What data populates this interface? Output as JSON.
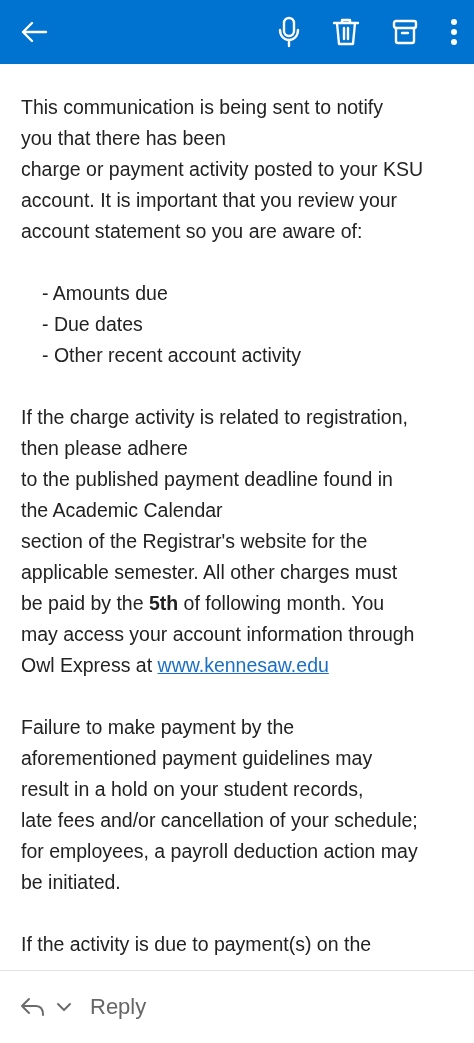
{
  "message": {
    "blocks": [
      {
        "kind": "paragraph",
        "lines": [
          "This communication is being sent to notify",
          "you that there has been",
          "charge or payment activity posted to your KSU",
          "account. It is important that you review your",
          "account statement so you are aware of:"
        ]
      },
      {
        "kind": "list",
        "lines": [
          "- Amounts due",
          "- Due dates",
          "- Other recent account activity"
        ]
      },
      {
        "kind": "paragraph",
        "lines": [
          "If the charge activity is related to registration,",
          "then please adhere",
          "to the published payment deadline found in",
          "the Academic Calendar",
          "section of the Registrar's website for the",
          "applicable semester. All other charges must",
          "be paid by the **5th** of following month. You",
          "may access your account information through",
          "Owl Express at "
        ],
        "link": "www.kennesaw.edu"
      },
      {
        "kind": "paragraph",
        "lines": [
          "Failure to make payment by the",
          "aforementioned payment guidelines may",
          "result in a hold on your student records,",
          "late fees and/or cancellation of your schedule;",
          "for employees, a payroll deduction action may",
          "be initiated."
        ]
      },
      {
        "kind": "paragraph",
        "lines": [
          "If the activity is due to payment(s) on the"
        ]
      }
    ]
  },
  "reply_bar": {
    "label": "Reply"
  }
}
